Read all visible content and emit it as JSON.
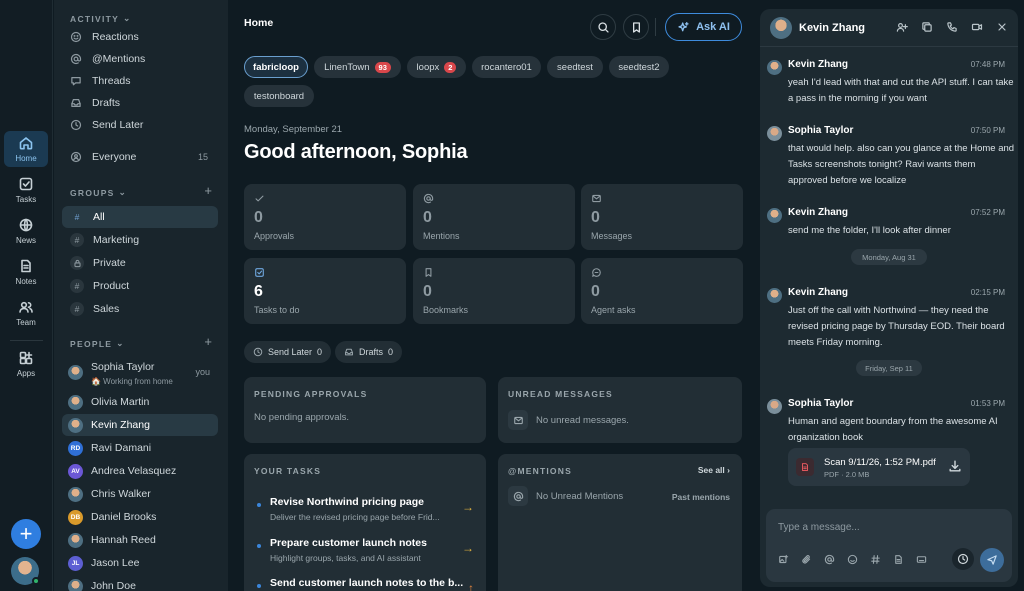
{
  "rail": {
    "items": [
      {
        "label": "Home",
        "icon": "home-icon"
      },
      {
        "label": "Tasks",
        "icon": "check-square-icon"
      },
      {
        "label": "News",
        "icon": "globe-icon"
      },
      {
        "label": "Notes",
        "icon": "document-icon"
      },
      {
        "label": "Team",
        "icon": "users-icon"
      },
      {
        "label": "Apps",
        "icon": "apps-icon"
      }
    ],
    "add_label": "+"
  },
  "sidebar": {
    "activity_header": "ACTIVITY",
    "activity": [
      {
        "label": "Reactions",
        "icon": "smile-icon"
      },
      {
        "label": "@Mentions",
        "icon": "at-icon"
      },
      {
        "label": "Threads",
        "icon": "thread-icon"
      },
      {
        "label": "Drafts",
        "icon": "inbox-icon"
      },
      {
        "label": "Send Later",
        "icon": "clock-icon"
      }
    ],
    "everyone": {
      "label": "Everyone",
      "count": "15"
    },
    "groups_header": "GROUPS",
    "groups": [
      {
        "label": "All",
        "icon": "#"
      },
      {
        "label": "Marketing",
        "icon": "#"
      },
      {
        "label": "Private",
        "icon": "lock-icon"
      },
      {
        "label": "Product",
        "icon": "#"
      },
      {
        "label": "Sales",
        "icon": "#"
      }
    ],
    "people_header": "PEOPLE",
    "self": {
      "name": "Sophia Taylor",
      "status": "🏠 Working from home",
      "tag": "you"
    },
    "people": [
      {
        "name": "Olivia Martin",
        "initials": "",
        "color": "#b7768a"
      },
      {
        "name": "Kevin Zhang",
        "initials": "",
        "color": "#4e6f82"
      },
      {
        "name": "Ravi Damani",
        "initials": "RD",
        "color": "#2f6fd6"
      },
      {
        "name": "Andrea Velasquez",
        "initials": "AV",
        "color": "#6b57d6"
      },
      {
        "name": "Chris Walker",
        "initials": "",
        "color": "#a87a45"
      },
      {
        "name": "Daniel Brooks",
        "initials": "DB",
        "color": "#d99a2b"
      },
      {
        "name": "Hannah Reed",
        "initials": "",
        "color": "#b15a58"
      },
      {
        "name": "Jason Lee",
        "initials": "JL",
        "color": "#5d5fd3"
      },
      {
        "name": "John Doe",
        "initials": "",
        "color": "#7a8c96"
      }
    ]
  },
  "main": {
    "title": "Home",
    "ask_ai_label": "Ask AI",
    "workspaces": [
      {
        "label": "fabricloop",
        "badge": ""
      },
      {
        "label": "LinenTown",
        "badge": "93"
      },
      {
        "label": "loopx",
        "badge": "2"
      },
      {
        "label": "rocantero01",
        "badge": ""
      },
      {
        "label": "seedtest",
        "badge": ""
      },
      {
        "label": "seedtest2",
        "badge": ""
      },
      {
        "label": "testonboard",
        "badge": ""
      }
    ],
    "date": "Monday, September 21",
    "greeting": "Good afternoon, Sophia",
    "stats": [
      {
        "value": "0",
        "label": "Approvals",
        "icon": "check-icon"
      },
      {
        "value": "0",
        "label": "Mentions",
        "icon": "at-icon"
      },
      {
        "value": "0",
        "label": "Messages",
        "icon": "mail-icon"
      },
      {
        "value": "6",
        "label": "Tasks to do",
        "icon": "checkbox-icon"
      },
      {
        "value": "0",
        "label": "Bookmarks",
        "icon": "bookmark-icon"
      },
      {
        "value": "0",
        "label": "Agent asks",
        "icon": "agent-icon"
      }
    ],
    "send_later": {
      "label": "Send Later",
      "count": "0"
    },
    "drafts": {
      "label": "Drafts",
      "count": "0"
    },
    "pending": {
      "title": "PENDING APPROVALS",
      "empty": "No pending approvals."
    },
    "unread": {
      "title": "UNREAD MESSAGES",
      "empty": "No unread messages."
    },
    "tasks": {
      "title": "YOUR TASKS",
      "items": [
        {
          "title": "Revise Northwind pricing page",
          "sub": "Deliver the revised pricing page before Frid..."
        },
        {
          "title": "Prepare customer launch notes",
          "sub": "Highlight groups, tasks, and AI assistant"
        },
        {
          "title": "Send customer launch notes to the b...",
          "sub": ""
        }
      ]
    },
    "mentions": {
      "title": "@MENTIONS",
      "see_all": "See all",
      "empty": "No Unread Mentions",
      "past": "Past mentions"
    }
  },
  "chat": {
    "name": "Kevin Zhang",
    "messages": [
      {
        "author": "Kevin Zhang",
        "time": "07:48 PM",
        "text": "yeah I'd lead with that and cut the API stuff. I can take a pass in the morning if you want",
        "who": "kevin"
      },
      {
        "author": "Sophia Taylor",
        "time": "07:50 PM",
        "text": "that would help. also can you glance at the Home and Tasks screenshots tonight? Ravi wants them approved before we localize",
        "who": "sophia"
      },
      {
        "author": "Kevin Zhang",
        "time": "07:52 PM",
        "text": "send me the folder, I'll look after dinner",
        "who": "kevin"
      },
      {
        "author": "Kevin Zhang",
        "time": "02:15 PM",
        "text": "Just off the call with Northwind — they need the revised pricing page by Thursday EOD. Their board meets Friday morning.",
        "who": "kevin"
      },
      {
        "author": "Sophia Taylor",
        "time": "01:53 PM",
        "text": "Human and agent boundary from the awesome AI organization book",
        "who": "sophia"
      }
    ],
    "date_dividers": [
      "Monday, Aug 31",
      "Friday, Sep 11"
    ],
    "attachment": {
      "name": "Scan 9/11/26, 1:52 PM.pdf",
      "meta": "PDF · 2.0 MB"
    },
    "composer_placeholder": "Type a message..."
  }
}
